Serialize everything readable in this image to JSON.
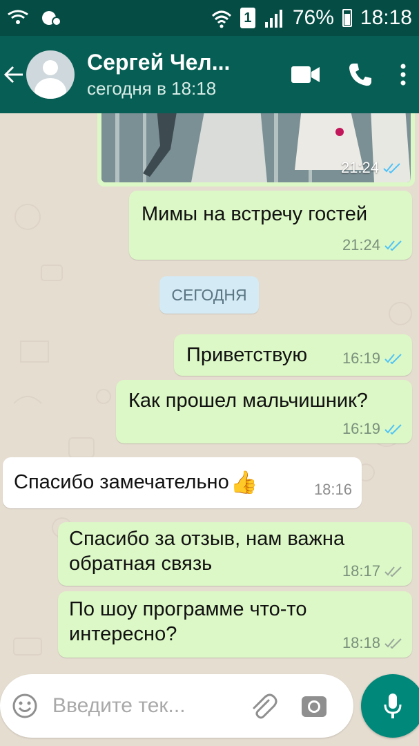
{
  "statusbar": {
    "battery": "76%",
    "time": "18:18",
    "sim": "1"
  },
  "header": {
    "contact_name": "Сергей Чел...",
    "contact_status": "сегодня в 18:18"
  },
  "chat": {
    "photo_message": {
      "time": "21:24",
      "read": true
    },
    "date_divider": "СЕГОДНЯ",
    "messages": [
      {
        "direction": "out",
        "text": "Мимы на встречу гостей",
        "time": "21:24",
        "read": true
      },
      {
        "direction": "out",
        "text": "Приветствую",
        "time": "16:19",
        "read": true
      },
      {
        "direction": "out",
        "text": "Как прошел мальчишник?",
        "time": "16:19",
        "read": true
      },
      {
        "direction": "in",
        "text": "Спасибо замечательно",
        "emoji": "👍",
        "time": "18:16"
      },
      {
        "direction": "out",
        "text": "Спасибо за отзыв, нам важна обратная связь",
        "time": "18:17",
        "read": false
      },
      {
        "direction": "out",
        "text": "По шоу программе что-то интересно?",
        "time": "18:18",
        "read": false
      }
    ]
  },
  "composer": {
    "placeholder": "Введите тек..."
  },
  "colors": {
    "header": "#075e54",
    "statusbar": "#054d44",
    "outgoing_bubble": "#dcf8c6",
    "incoming_bubble": "#ffffff",
    "read_ticks": "#4fc3f7",
    "fab": "#00897b"
  },
  "icons": [
    "back-arrow-icon",
    "avatar-icon",
    "video-call-icon",
    "phone-icon",
    "more-options-icon",
    "double-check-icon",
    "emoji-icon",
    "attach-icon",
    "camera-icon",
    "mic-icon"
  ]
}
